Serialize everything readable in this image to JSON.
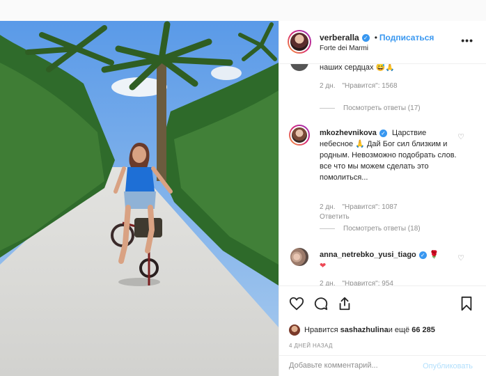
{
  "post": {
    "username": "verberalla",
    "follow_label": "Подписаться",
    "dot": "•",
    "location": "Forte dei Marmi",
    "more_icon": "more-options-icon"
  },
  "comments": {
    "partial_text": "наших сердцах 😅🙏",
    "first_meta": {
      "time": "2 дн.",
      "likes": "\"Нравится\": 1568"
    },
    "first_view_replies": "Посмотреть ответы (17)",
    "items": [
      {
        "username": "mkozhevnikova",
        "text": " Царствие небесное 🙏 Дай Бог сил близким и родным. Невозможно подобрать слов. все что мы можем сделать это помолиться...",
        "time": "2 дн.",
        "likes": "\"Нравится\": 1087",
        "reply": "Ответить",
        "view_replies": "Посмотреть ответы (18)"
      },
      {
        "username": "anna_netrebko_yusi_tiago",
        "text_suffix": "🌹",
        "heart": "❤",
        "time": "2 дн.",
        "likes": "\"Нравится\": 954"
      }
    ]
  },
  "actions": {
    "liked_by_prefix": "Нравится ",
    "liked_by_user": "sashazhulina",
    "liked_by_suffix": " и ещё ",
    "liked_by_count": "66 285",
    "time_ago": "4 ДНЕЙ НАЗАД"
  },
  "add_comment": {
    "placeholder": "Добавьте комментарий...",
    "publish_label": "Опубликовать"
  },
  "colors": {
    "accent": "#3897f0",
    "publish_disabled": "#b2dffc",
    "muted": "#8e8e8e"
  }
}
